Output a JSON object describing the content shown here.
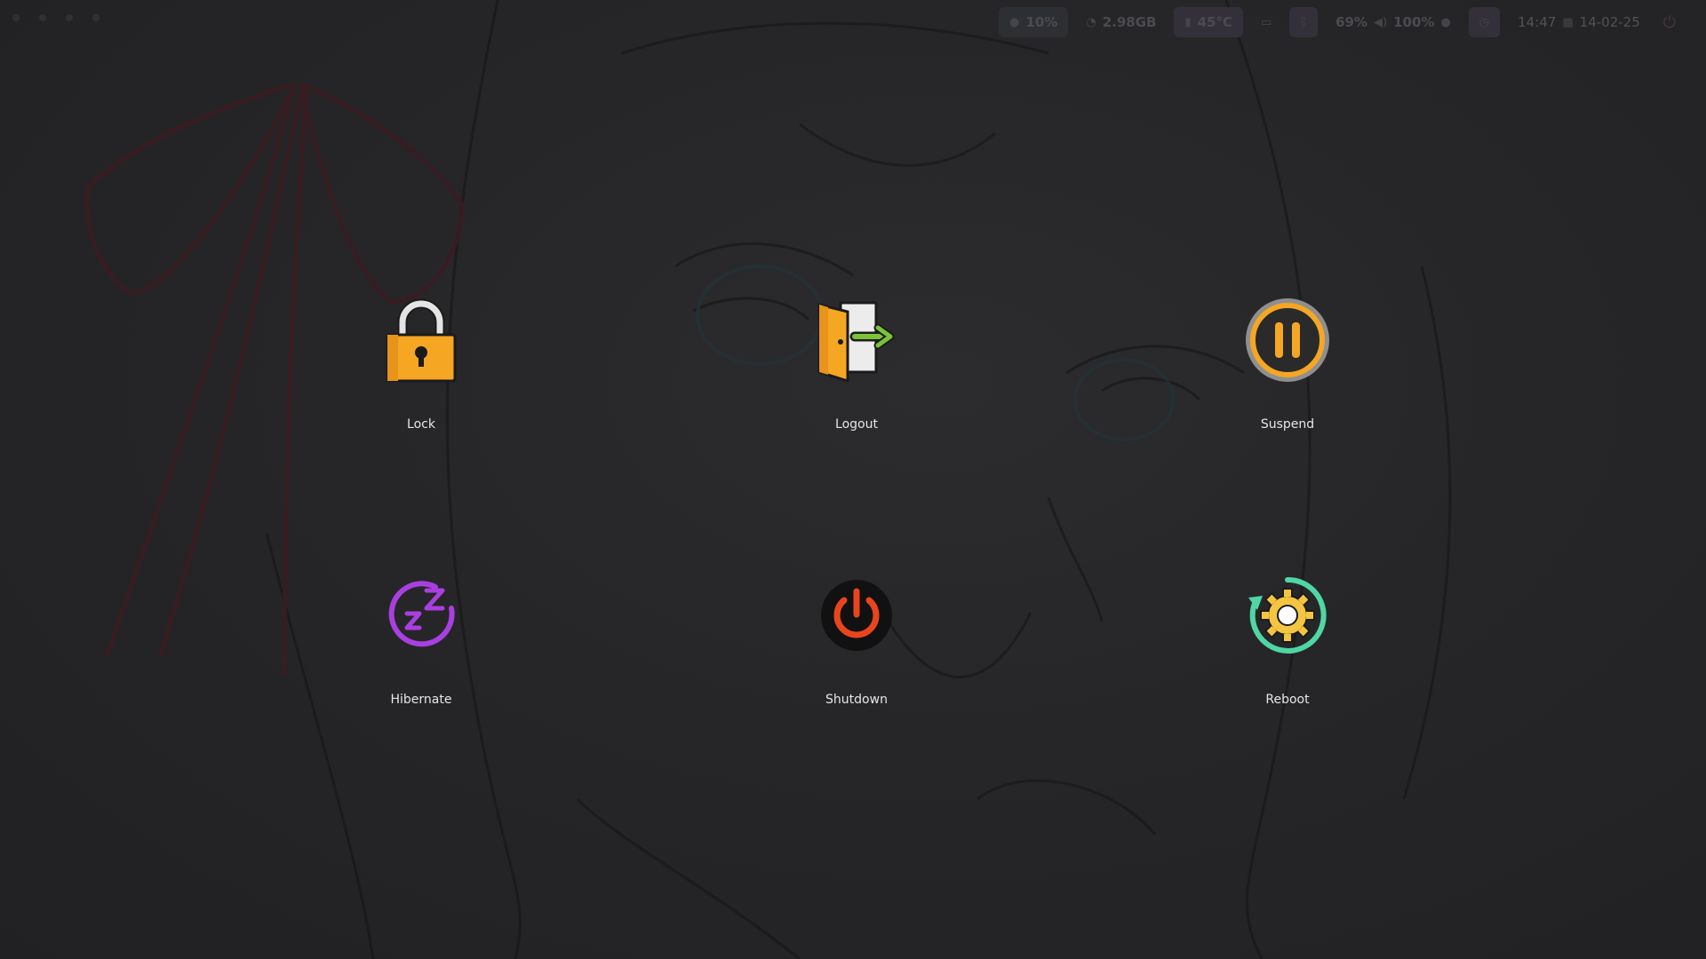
{
  "statusbar": {
    "cpu": "10%",
    "memory": "2.98GB",
    "temperature": "45°C",
    "brightness": "69%",
    "volume": "100%",
    "time": "14:47",
    "date": "14-02-25",
    "icons": {
      "cpu": "cpu-icon",
      "memory": "memory-icon",
      "temperature": "thermometer-icon",
      "display": "monitor-icon",
      "bluetooth": "bluetooth-icon",
      "volume": "speaker-icon",
      "mic": "microphone-icon",
      "clock": "clock-icon",
      "calendar": "calendar-icon",
      "power": "power-icon"
    }
  },
  "menu": {
    "items": [
      {
        "label": "Lock",
        "icon": "padlock-icon",
        "color": "#F5A623"
      },
      {
        "label": "Logout",
        "icon": "door-exit-icon",
        "color": "#F5A623"
      },
      {
        "label": "Suspend",
        "icon": "pause-icon",
        "color": "#F5A623"
      },
      {
        "label": "Hibernate",
        "icon": "sleep-zz-icon",
        "color": "#A93FE0"
      },
      {
        "label": "Shutdown",
        "icon": "power-icon",
        "color": "#E8451E"
      },
      {
        "label": "Reboot",
        "icon": "gear-refresh-icon",
        "color": "#4FD6A4"
      }
    ]
  },
  "colors": {
    "background": "#232426",
    "label": "#E6E6E6"
  }
}
